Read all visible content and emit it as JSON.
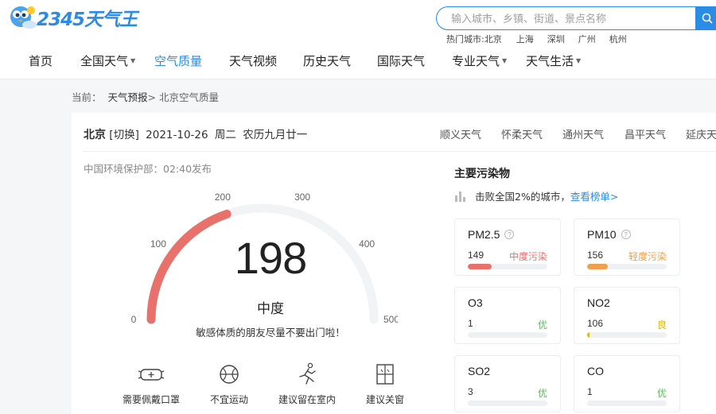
{
  "logo": {
    "text": "2345天气王"
  },
  "search": {
    "placeholder": "输入城市、乡镇、街道、景点名称"
  },
  "hot_cities": {
    "label": "热门城市:北京",
    "cities": [
      "上海",
      "深圳",
      "广州",
      "杭州"
    ]
  },
  "nav": {
    "items": [
      {
        "label": "首页",
        "dropdown": false
      },
      {
        "label": "全国天气",
        "dropdown": true
      },
      {
        "label": "空气质量",
        "dropdown": false,
        "active": true
      },
      {
        "label": "天气视频",
        "dropdown": false
      },
      {
        "label": "历史天气",
        "dropdown": false
      },
      {
        "label": "国际天气",
        "dropdown": false
      },
      {
        "label": "专业天气",
        "dropdown": true
      },
      {
        "label": "天气生活",
        "dropdown": true
      }
    ]
  },
  "breadcrumb": {
    "prefix": "当前：",
    "link": "天气预报",
    "current": "> 北京空气质量"
  },
  "header": {
    "city": "北京",
    "switch_label": "[切换]",
    "date": "2021-10-26",
    "weekday": "周二",
    "lunar": "农历九月廿一",
    "nearby": [
      "顺义天气",
      "怀柔天气",
      "通州天气",
      "昌平天气",
      "延庆天"
    ]
  },
  "publish": "中国环境保护部：02:40发布",
  "aqi": {
    "value": "198",
    "value_num": 198,
    "max": 500,
    "level": "中度",
    "tip": "敏感体质的朋友尽量不要出门啦！",
    "ticks": [
      "0",
      "100",
      "200",
      "300",
      "400",
      "500"
    ],
    "color": "#e8716b"
  },
  "advice": [
    {
      "icon": "mask-icon",
      "label": "需要佩戴口罩"
    },
    {
      "icon": "basketball-icon",
      "label": "不宜运动"
    },
    {
      "icon": "running-person-icon",
      "label": "建议留在室内"
    },
    {
      "icon": "window-icon",
      "label": "建议关窗"
    }
  ],
  "pollutants": {
    "title": "主要污染物",
    "rank_text": "击败全国2%的城市，",
    "rank_link": "查看榜单>",
    "items": [
      {
        "name": "PM2.5",
        "value": "149",
        "level": "中度污染",
        "color": "#e8716b",
        "fraction": 0.3,
        "help": true
      },
      {
        "name": "PM10",
        "value": "156",
        "level": "轻度污染",
        "color": "#f0a04a",
        "fraction": 0.26,
        "help": true
      },
      {
        "name": "O3",
        "value": "1",
        "level": "优",
        "color": "#5cb85c",
        "fraction": 0.0,
        "help": false
      },
      {
        "name": "NO2",
        "value": "106",
        "level": "良",
        "color": "#e6b800",
        "fraction": 0.02,
        "help": false
      },
      {
        "name": "SO2",
        "value": "3",
        "level": "优",
        "color": "#5cb85c",
        "fraction": 0.0,
        "help": false
      },
      {
        "name": "CO",
        "value": "1",
        "level": "优",
        "color": "#5cb85c",
        "fraction": 0.0,
        "help": false
      }
    ]
  },
  "colors": {
    "accent": "#2a8ce6"
  }
}
